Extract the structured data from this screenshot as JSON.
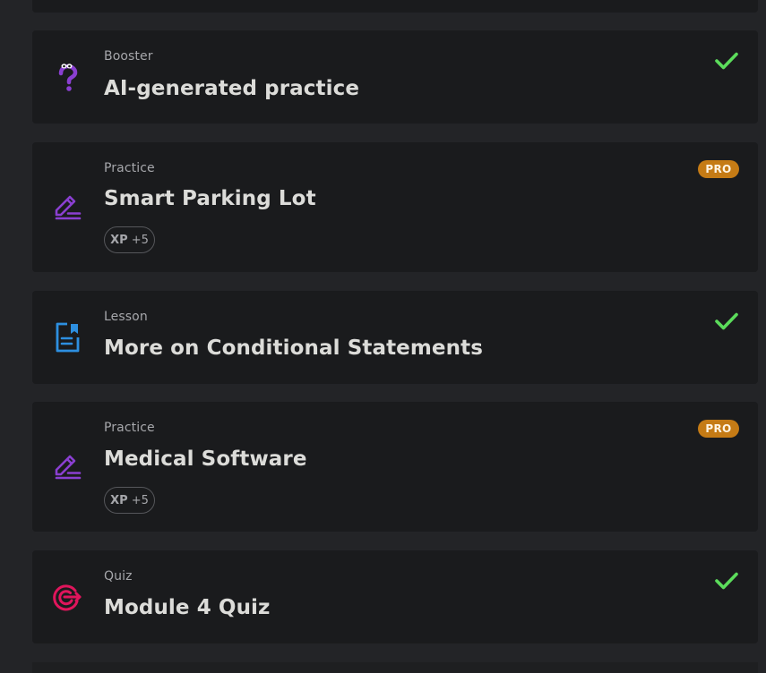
{
  "colors": {
    "page_bg": "#232427",
    "card_bg": "#1a1b1d",
    "practice_icon": "#8a3fd1",
    "booster_icon": "#8a3fd1",
    "lesson_icon": "#2d8fe0",
    "quiz_icon": "#e0155c",
    "check": "#5bdc5b",
    "pro_badge": "#c57b15"
  },
  "items": [
    {
      "kind": "Booster",
      "title": "AI-generated practice",
      "icon": "question-mark-eyes-icon",
      "status": "completed"
    },
    {
      "kind": "Practice",
      "title": "Smart Parking Lot",
      "icon": "pencil-edit-icon",
      "badge": "PRO",
      "xp_label": "XP",
      "xp_value": "+5"
    },
    {
      "kind": "Lesson",
      "title": "More on Conditional Statements",
      "icon": "document-bookmark-icon",
      "status": "completed"
    },
    {
      "kind": "Practice",
      "title": "Medical Software",
      "icon": "pencil-edit-icon",
      "badge": "PRO",
      "xp_label": "XP",
      "xp_value": "+5"
    },
    {
      "kind": "Quiz",
      "title": "Module 4 Quiz",
      "icon": "target-arrow-icon",
      "status": "completed"
    }
  ]
}
